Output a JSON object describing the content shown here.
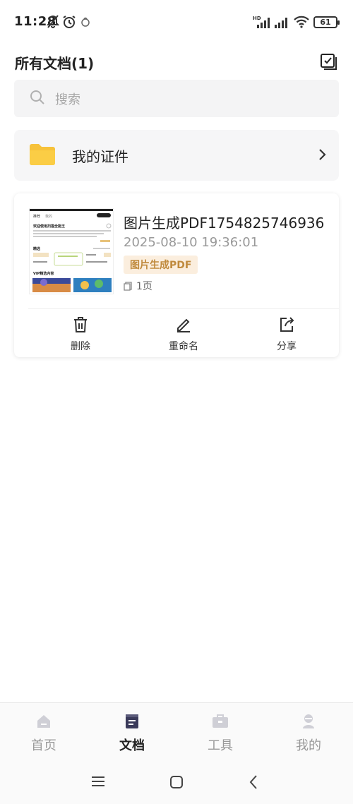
{
  "status_bar": {
    "time": "11:28",
    "battery": "61",
    "network": "HD"
  },
  "header": {
    "title": "所有文档(1)"
  },
  "search": {
    "placeholder": "搜索"
  },
  "folder": {
    "label": "我的证件"
  },
  "document": {
    "name": "图片生成PDF1754825746936",
    "date": "2025-08-10  19:36:01",
    "tag": "图片生成PDF",
    "pages": "1页",
    "actions": {
      "delete": "删除",
      "rename": "重命名",
      "share": "分享"
    },
    "thumbnail": {
      "tab_left": "推荐",
      "tab_right": "我的",
      "heading": "欢迎使用扫描全能王",
      "text": "扫描文件、图片转PDF、文字识别、证件扫描…",
      "section": "精选",
      "vip": "VIP精选内容"
    }
  },
  "bottom_nav": {
    "items": [
      {
        "label": "首页",
        "icon": "home-icon"
      },
      {
        "label": "文档",
        "icon": "document-icon"
      },
      {
        "label": "工具",
        "icon": "toolbox-icon"
      },
      {
        "label": "我的",
        "icon": "profile-icon"
      }
    ],
    "active": "文档"
  },
  "colors": {
    "accent_tag_bg": "#fbeede",
    "accent_tag_text": "#c08a3d",
    "folder_yellow": "#f7c23a",
    "active_nav": "#3a3a5a"
  }
}
